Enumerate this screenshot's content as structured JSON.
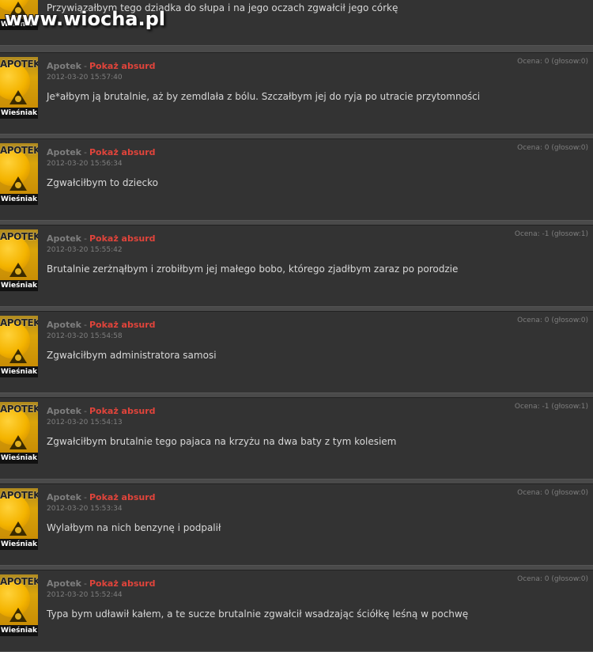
{
  "watermark": "www.wiocha.pl",
  "rank_label": "Wieśniak",
  "avatar_text": "APOTEK",
  "author": "Apotek",
  "separator": "-",
  "absurd_label": "Pokaż absurd",
  "top_partial": {
    "text": "Przywiązałbym tego dziadka do słupa i na jego oczach zgwałcił jego córkę"
  },
  "comments": [
    {
      "date": "2012-03-20 15:57:40",
      "rating": "Ocena: 0 (głosow:0)",
      "text": "Je*ałbym ją brutalnie, aż by zemdlała z bólu. Szczałbym jej do ryja po utracie przytomności"
    },
    {
      "date": "2012-03-20 15:56:34",
      "rating": "Ocena: 0 (głosow:0)",
      "text": "Zgwałciłbym to dziecko"
    },
    {
      "date": "2012-03-20 15:55:42",
      "rating": "Ocena: -1 (głosow:1)",
      "text": "Brutalnie zerżnąłbym i zrobiłbym jej małego bobo, którego zjadłbym zaraz po porodzie"
    },
    {
      "date": "2012-03-20 15:54:58",
      "rating": "Ocena: 0 (głosow:0)",
      "text": "Zgwałciłbym administratora samosi"
    },
    {
      "date": "2012-03-20 15:54:13",
      "rating": "Ocena: -1 (głosow:1)",
      "text": "Zgwałciłbym brutalnie tego pajaca na krzyżu na dwa baty z tym kolesiem"
    },
    {
      "date": "2012-03-20 15:53:34",
      "rating": "Ocena: 0 (głosow:0)",
      "text": "Wylałbym na nich benzynę i podpalił"
    },
    {
      "date": "2012-03-20 15:52:44",
      "rating": "Ocena: 0 (głosow:0)",
      "text": "Typa bym udławił kałem, a te sucze brutalnie zgwałcił wsadzając ściółkę leśną w pochwę"
    }
  ]
}
